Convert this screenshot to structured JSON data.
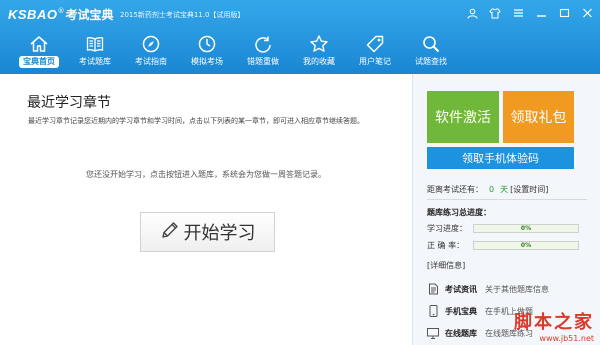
{
  "header": {
    "logo_en": "KSBAO",
    "logo_reg": "®",
    "logo_cn": "考试宝典",
    "title": "2015新药剂士考试宝典11.0【试用版】"
  },
  "window_controls": [
    "user-icon",
    "skin-icon",
    "menu-icon",
    "minimize-icon",
    "maximize-icon",
    "close-icon"
  ],
  "nav": [
    {
      "label": "宝典首页",
      "icon": "home-icon",
      "active": true
    },
    {
      "label": "考试题库",
      "icon": "book-icon",
      "active": false
    },
    {
      "label": "考试指南",
      "icon": "compass-icon",
      "active": false
    },
    {
      "label": "模拟考场",
      "icon": "clock-icon",
      "active": false
    },
    {
      "label": "错题重做",
      "icon": "redo-icon",
      "active": false
    },
    {
      "label": "我的收藏",
      "icon": "star-icon",
      "active": false
    },
    {
      "label": "用户笔记",
      "icon": "tag-icon",
      "active": false
    },
    {
      "label": "试题查找",
      "icon": "search-icon",
      "active": false
    }
  ],
  "main": {
    "title": "最近学习章节",
    "description": "最近学习章节记录您近期内的学习章节和学习时间，点击以下列表的某一章节，即可进入相应章节继续答题。",
    "empty_message": "您还没开始学习，点击按钮进入题库，系统会为您做一周答题记录。",
    "start_button": "开始学习"
  },
  "side": {
    "activate_label": "软件激活",
    "gift_label": "领取礼包",
    "code_label": "领取手机体验码",
    "exam_prefix": "距离考试还有：",
    "exam_days": "0",
    "exam_unit": "天",
    "set_time": "[设置时间]",
    "progress_title": "题库练习总进度：",
    "progress": [
      {
        "label": "学习进度：",
        "value": "0%",
        "fraction": 0
      },
      {
        "label": "正 确 率：",
        "value": "0%",
        "fraction": 0
      }
    ],
    "detail_link": "[详细信息]",
    "info": [
      {
        "icon": "document-icon",
        "name": "考试资讯",
        "desc": "关于其他题库信息"
      },
      {
        "icon": "phone-icon",
        "name": "手机宝典",
        "desc": "在手机上做题"
      },
      {
        "icon": "monitor-icon",
        "name": "在线题库",
        "desc": "在线题库练习"
      }
    ]
  },
  "watermark": {
    "big": "脚本之家",
    "small": "www.jb51.net"
  },
  "colors": {
    "header": "#1a86d3",
    "activate": "#6fb83a",
    "gift": "#f19a22",
    "code": "#1d92de"
  }
}
